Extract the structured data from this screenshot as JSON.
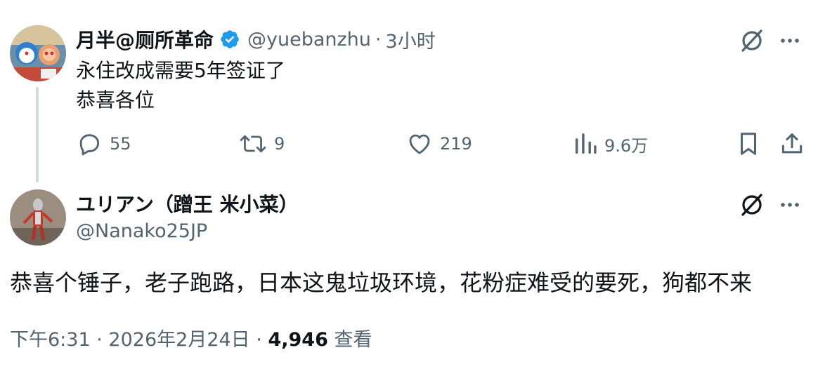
{
  "tweet1": {
    "display_name": "月半@厕所革命",
    "verified": true,
    "handle": "@yuebanzhu",
    "separator": "·",
    "time": "3小时",
    "text_line1": "永住改成需要5年签证了",
    "text_line2": "恭喜各位",
    "stats": {
      "replies": "55",
      "retweets": "9",
      "likes": "219",
      "views": "9.6万"
    }
  },
  "tweet2": {
    "display_name": "ユリアン（蹭王 米小菜）",
    "handle": "@Nanako25JP",
    "text": "恭喜个锤子，老子跑路，日本这鬼垃圾环境，花粉症难受的要死，狗都不来",
    "meta": {
      "time": "下午6:31",
      "separator": "·",
      "date": "2026年2月24日",
      "views_count": "4,946",
      "views_label": "查看"
    }
  },
  "colors": {
    "text_primary": "#0f1419",
    "text_secondary": "#536471",
    "verified_blue": "#1d9bf0",
    "thread_line": "#cfd9de"
  },
  "icons": [
    "grok-icon",
    "more-icon",
    "reply-icon",
    "retweet-icon",
    "like-icon",
    "views-icon",
    "bookmark-icon",
    "share-icon",
    "verified-badge-icon"
  ]
}
